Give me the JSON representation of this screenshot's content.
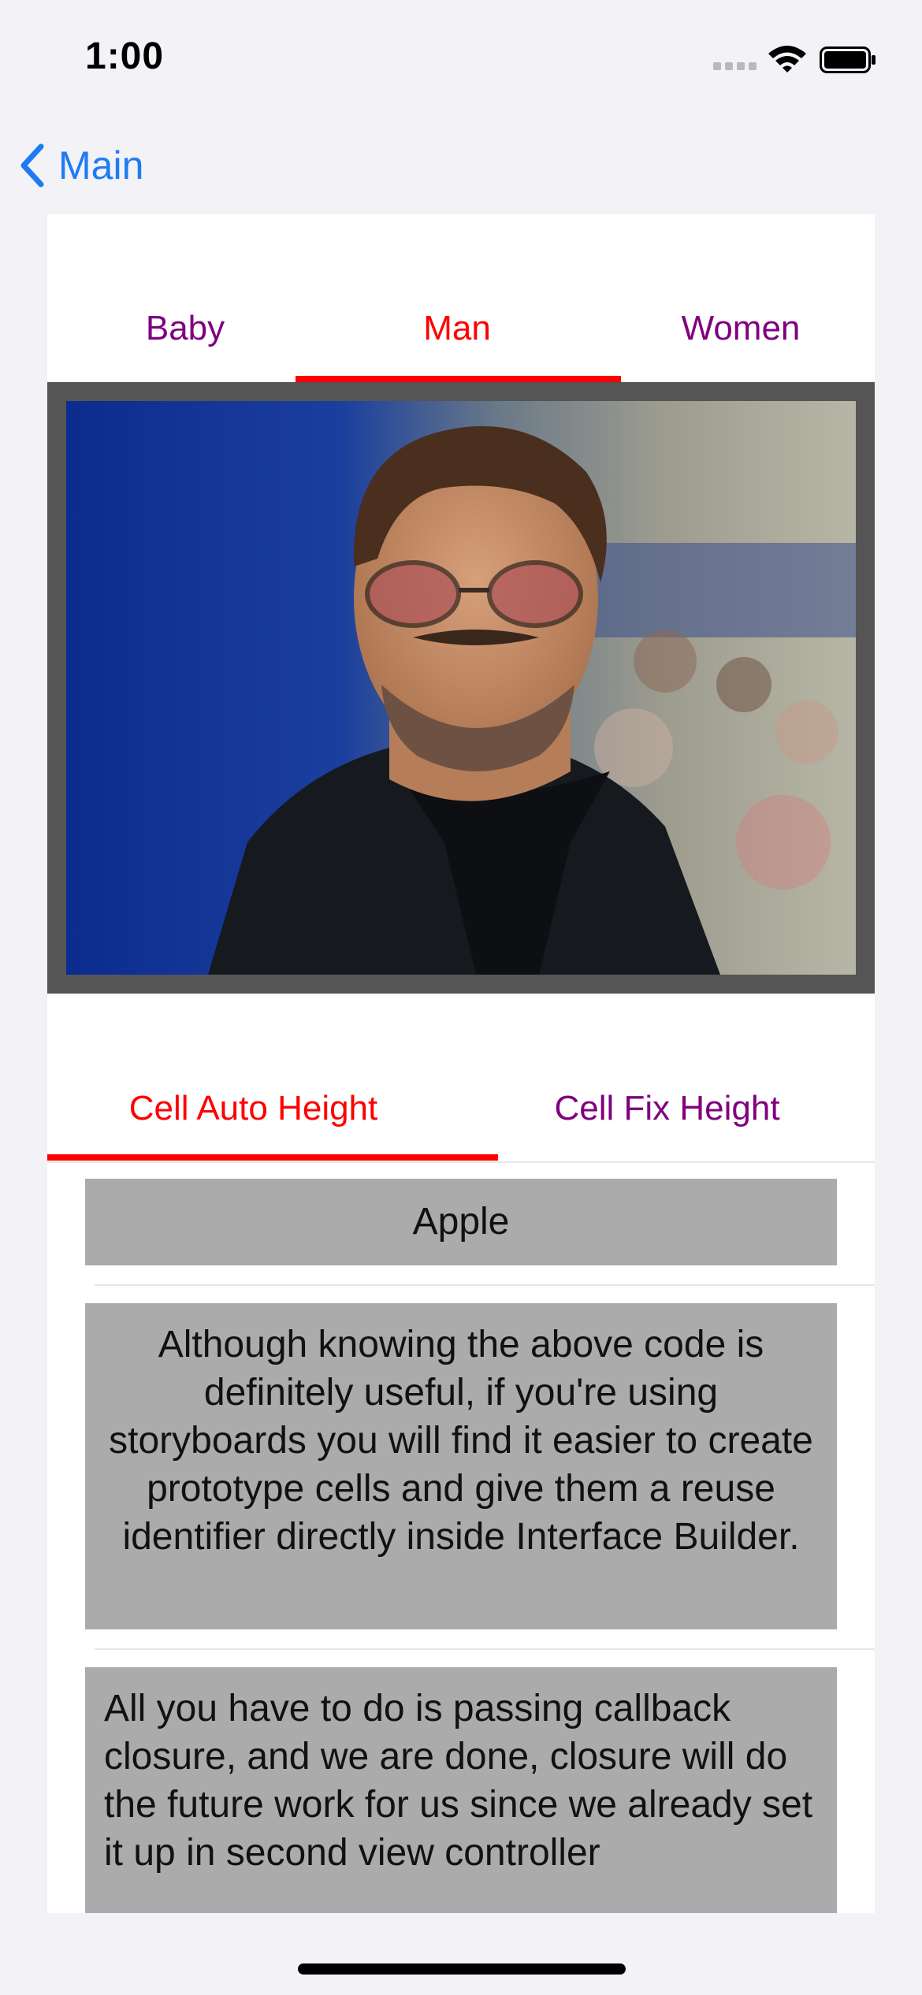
{
  "status_bar": {
    "time": "1:00"
  },
  "nav": {
    "back_label": "Main"
  },
  "top_tabs": {
    "items": [
      "Baby",
      "Man",
      "Women"
    ],
    "selected": "Man"
  },
  "bottom_tabs": {
    "items": [
      "Cell Auto Height",
      "Cell Fix Height"
    ],
    "selected": "Cell Auto Height"
  },
  "cells": [
    "Apple",
    "Although knowing the above code is definitely useful, if you're using storyboards you will find it easier to create prototype cells and give them a reuse identifier directly inside Interface Builder.",
    "All you have to do is passing callback closure, and we are done, closure will do the future work for us since we already set it up in second view controller"
  ],
  "colors": {
    "tint": "#1E7BF2",
    "tab_selected": "#FF0000",
    "tab_unselected": "#800080",
    "cell_background": "#ABABAB",
    "photo_frame": "#555555"
  },
  "icons": [
    "chevron-left-icon",
    "signal-icon",
    "wifi-icon",
    "battery-icon"
  ]
}
